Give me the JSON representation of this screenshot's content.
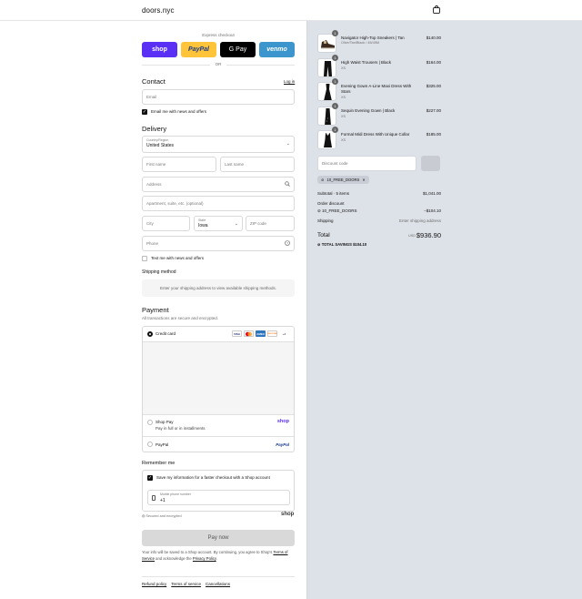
{
  "header": {
    "brand": "doors.nyc",
    "cart_icon": "shopping-bag-icon"
  },
  "express": {
    "label": "Express checkout",
    "buttons": {
      "shop": "shop",
      "paypal": "PayPal",
      "gpay": "G Pay",
      "venmo": "venmo"
    },
    "or": "OR"
  },
  "contact": {
    "heading": "Contact",
    "login": "Log in",
    "email_placeholder": "Email",
    "news_label": "Email me with news and offers"
  },
  "delivery": {
    "heading": "Delivery",
    "country_label": "Country/Region",
    "country_value": "United States",
    "first_name": "First name",
    "last_name": "Last name",
    "address": "Address",
    "apartment": "Apartment, suite, etc. (optional)",
    "city": "City",
    "state_label": "State",
    "state_value": "Iowa",
    "zip": "ZIP code",
    "phone": "Phone",
    "text_label": "Text me with news and offers"
  },
  "shipping": {
    "heading": "Shipping method",
    "notice": "Enter your shipping address to view available shipping methods."
  },
  "payment": {
    "heading": "Payment",
    "sub": "All transactions are secure and encrypted.",
    "credit_card": "Credit card",
    "card_logos": [
      "VISA",
      "MC",
      "AMEX",
      "DISCOVER"
    ],
    "more_cards": "+4",
    "shop_pay": "Shop Pay",
    "shop_pay_sub": "Pay in full or in installments",
    "shop_pay_logo": "shop",
    "paypal": "PayPal",
    "paypal_logo": "PayPal"
  },
  "remember": {
    "heading": "Remember me",
    "save_label": "Save my information for a faster checkout with a Shop account",
    "mobile_label": "Mobile phone number",
    "mobile_value": "+1",
    "secure": "Secured and encrypted",
    "shop_logo": "shop"
  },
  "pay_now": "Pay now",
  "fineprint": {
    "text1": "Your info will be saved to a Shop account. By continuing, you agree to Shop's",
    "terms": "Terms of Service",
    "text2": "and acknowledge the",
    "privacy": "Privacy Policy",
    "text3": "."
  },
  "footer": [
    "Refund policy",
    "Terms of service",
    "Cancellations"
  ],
  "summary": {
    "items": [
      {
        "qty": "1",
        "name": "Navigator High-Top Sneakers | Tan",
        "variant": "Olive/Tan/Black / 46/45M",
        "price": "$140.00",
        "kind": "sneaker"
      },
      {
        "qty": "1",
        "name": "High Waist Trousers | Black",
        "variant": "XS",
        "price": "$164.00",
        "kind": "trousers"
      },
      {
        "qty": "1",
        "name": "Evening Gown A-Line Maxi Dress With Stars",
        "variant": "XS",
        "price": "$325.00",
        "kind": "gown"
      },
      {
        "qty": "1",
        "name": "Sequin Evening Gown | Black",
        "variant": "XS",
        "price": "$227.00",
        "kind": "sequin"
      },
      {
        "qty": "1",
        "name": "Formal Midi Dress With Unique Collar",
        "variant": "XS",
        "price": "$185.00",
        "kind": "midi"
      }
    ],
    "discount_placeholder": "Discount code",
    "discount_tag": "10_FREE_DOORS",
    "subtotal_label": "Subtotal · 5 items",
    "subtotal": "$1,041.00",
    "order_discount": "Order discount",
    "discount_code": "10_FREE_DOORS",
    "discount_amount": "−$104.10",
    "shipping_label": "Shipping",
    "shipping_value": "Enter shipping address",
    "total_label": "Total",
    "currency": "USD",
    "total": "$936.90",
    "savings_label": "TOTAL SAVINGS",
    "savings": "$104.10"
  },
  "colors": {
    "shop": "#5a31f4",
    "paypal": "#ffc439",
    "venmo": "#3d95ce",
    "panel": "#dde1e8"
  }
}
